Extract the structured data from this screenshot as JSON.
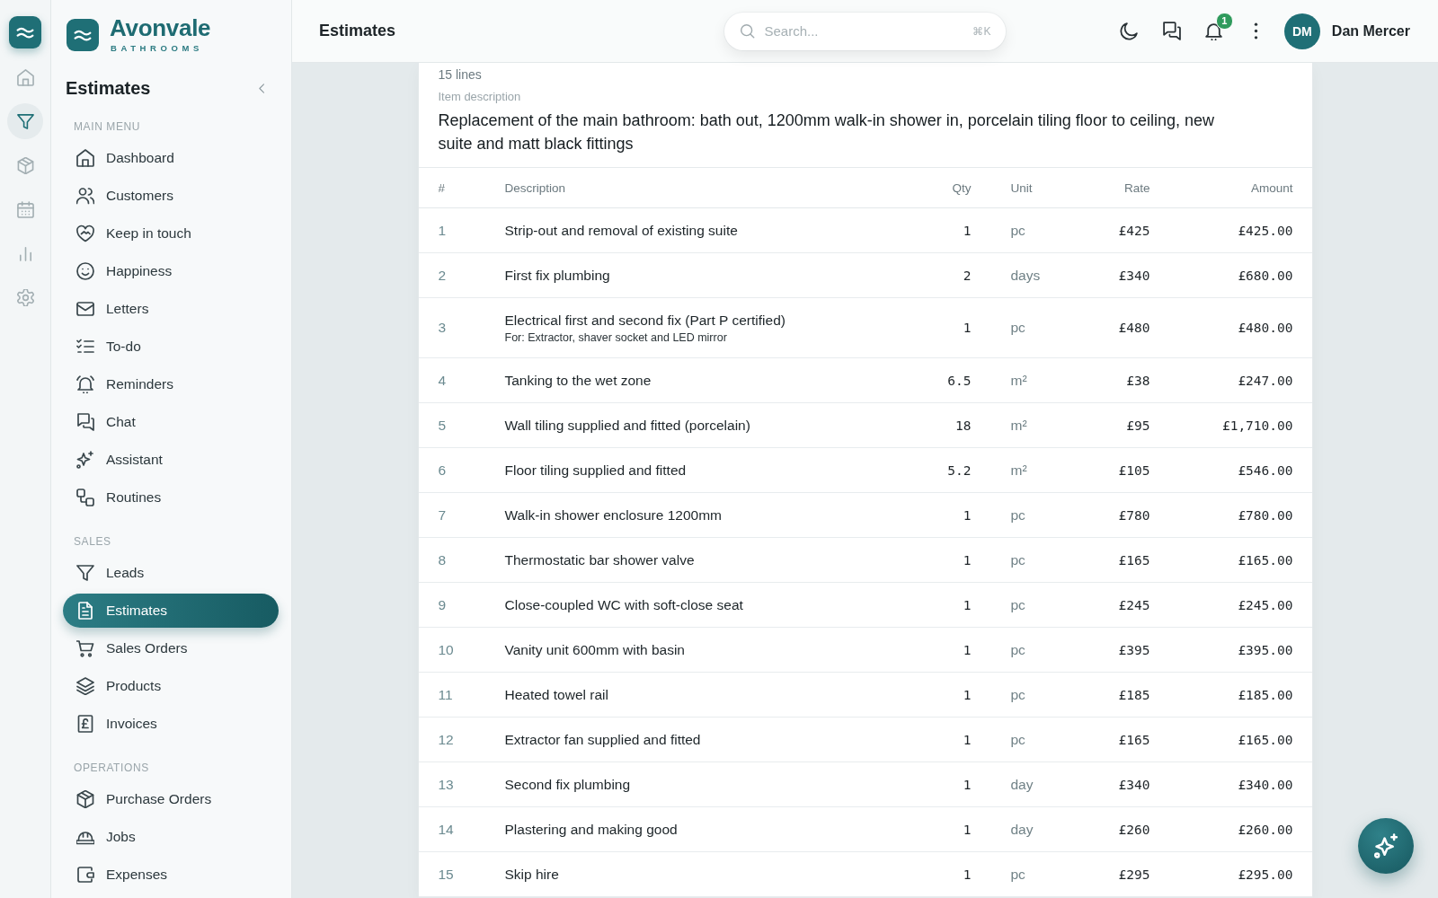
{
  "rail": {
    "items": [
      {
        "selected": false
      },
      {
        "selected": true
      },
      {
        "selected": false
      },
      {
        "selected": false
      },
      {
        "selected": false
      },
      {
        "selected": false
      }
    ]
  },
  "brand": {
    "name": "Avonvale",
    "tagline": "BATHROOMS"
  },
  "sidebar": {
    "title": "Estimates",
    "sections": [
      {
        "heading": "MAIN MENU",
        "items": [
          {
            "label": "Dashboard",
            "selected": false
          },
          {
            "label": "Customers",
            "selected": false
          },
          {
            "label": "Keep in touch",
            "selected": false
          },
          {
            "label": "Happiness",
            "selected": false
          },
          {
            "label": "Letters",
            "selected": false
          },
          {
            "label": "To-do",
            "selected": false
          },
          {
            "label": "Reminders",
            "selected": false
          },
          {
            "label": "Chat",
            "selected": false
          },
          {
            "label": "Assistant",
            "selected": false
          },
          {
            "label": "Routines",
            "selected": false
          }
        ]
      },
      {
        "heading": "SALES",
        "items": [
          {
            "label": "Leads",
            "selected": false
          },
          {
            "label": "Estimates",
            "selected": true
          },
          {
            "label": "Sales Orders",
            "selected": false
          },
          {
            "label": "Products",
            "selected": false
          },
          {
            "label": "Invoices",
            "selected": false
          }
        ]
      },
      {
        "heading": "OPERATIONS",
        "items": [
          {
            "label": "Purchase Orders",
            "selected": false
          },
          {
            "label": "Jobs",
            "selected": false
          },
          {
            "label": "Expenses",
            "selected": false
          }
        ]
      }
    ]
  },
  "header": {
    "title": "Estimates",
    "search": {
      "placeholder": "Search...",
      "shortcut": "⌘K"
    },
    "notifications": {
      "count": "1"
    },
    "user": {
      "initials": "DM",
      "name": "Dan Mercer"
    }
  },
  "estimate": {
    "line_count": "15 lines",
    "description_label": "Item description",
    "description": "Replacement of the main bathroom: bath out, 1200mm walk-in shower in, porcelain tiling floor to ceiling, new suite and matt black fittings",
    "table": {
      "columns": [
        "#",
        "Description",
        "Qty",
        "Unit",
        "Rate",
        "Amount"
      ],
      "rows": [
        {
          "number": "1",
          "description": "Strip-out and removal of existing suite",
          "qty": "1",
          "unit": "pc",
          "rate": "£425",
          "amount": "£425.00"
        },
        {
          "number": "2",
          "description": "First fix plumbing",
          "qty": "2",
          "unit": "days",
          "rate": "£340",
          "amount": "£680.00"
        },
        {
          "number": "3",
          "description": "Electrical first and second fix (Part P certified)",
          "note": "For: Extractor, shaver socket and LED mirror",
          "qty": "1",
          "unit": "pc",
          "rate": "£480",
          "amount": "£480.00"
        },
        {
          "number": "4",
          "description": "Tanking to the wet zone",
          "qty": "6.5",
          "unit": "m²",
          "rate": "£38",
          "amount": "£247.00"
        },
        {
          "number": "5",
          "description": "Wall tiling supplied and fitted (porcelain)",
          "qty": "18",
          "unit": "m²",
          "rate": "£95",
          "amount": "£1,710.00"
        },
        {
          "number": "6",
          "description": "Floor tiling supplied and fitted",
          "qty": "5.2",
          "unit": "m²",
          "rate": "£105",
          "amount": "£546.00"
        },
        {
          "number": "7",
          "description": "Walk-in shower enclosure 1200mm",
          "qty": "1",
          "unit": "pc",
          "rate": "£780",
          "amount": "£780.00"
        },
        {
          "number": "8",
          "description": "Thermostatic bar shower valve",
          "qty": "1",
          "unit": "pc",
          "rate": "£165",
          "amount": "£165.00"
        },
        {
          "number": "9",
          "description": "Close-coupled WC with soft-close seat",
          "qty": "1",
          "unit": "pc",
          "rate": "£245",
          "amount": "£245.00"
        },
        {
          "number": "10",
          "description": "Vanity unit 600mm with basin",
          "qty": "1",
          "unit": "pc",
          "rate": "£395",
          "amount": "£395.00"
        },
        {
          "number": "11",
          "description": "Heated towel rail",
          "qty": "1",
          "unit": "pc",
          "rate": "£185",
          "amount": "£185.00"
        },
        {
          "number": "12",
          "description": "Extractor fan supplied and fitted",
          "qty": "1",
          "unit": "pc",
          "rate": "£165",
          "amount": "£165.00"
        },
        {
          "number": "13",
          "description": "Second fix plumbing",
          "qty": "1",
          "unit": "day",
          "rate": "£340",
          "amount": "£340.00"
        },
        {
          "number": "14",
          "description": "Plastering and making good",
          "qty": "1",
          "unit": "day",
          "rate": "£260",
          "amount": "£260.00"
        },
        {
          "number": "15",
          "description": "Skip hire",
          "qty": "1",
          "unit": "pc",
          "rate": "£295",
          "amount": "£295.00"
        }
      ]
    }
  }
}
